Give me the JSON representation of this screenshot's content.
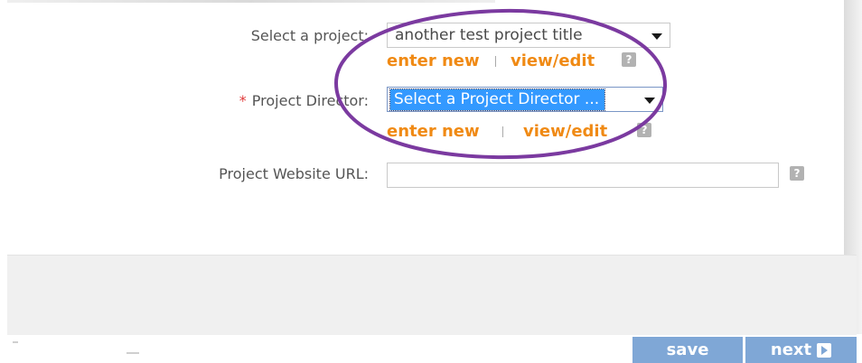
{
  "form": {
    "select_project": {
      "label": "Select a project:",
      "value": "another test project title",
      "enter_new": "enter new",
      "view_edit": "view/edit",
      "help": "?"
    },
    "project_director": {
      "required_mark": "*",
      "label": "Project Director:",
      "value": "Select a Project Director ...",
      "enter_new": "enter new",
      "view_edit": "view/edit",
      "help": "?"
    },
    "website_url": {
      "label": "Project Website URL:",
      "value": "",
      "help": "?"
    }
  },
  "footer": {
    "save_label": "save",
    "next_label": "next"
  },
  "colors": {
    "link_orange": "#f08a14",
    "button_blue": "#7fa7d6",
    "annotation_purple": "#7b3aa0",
    "required_red": "#e03a3a"
  }
}
